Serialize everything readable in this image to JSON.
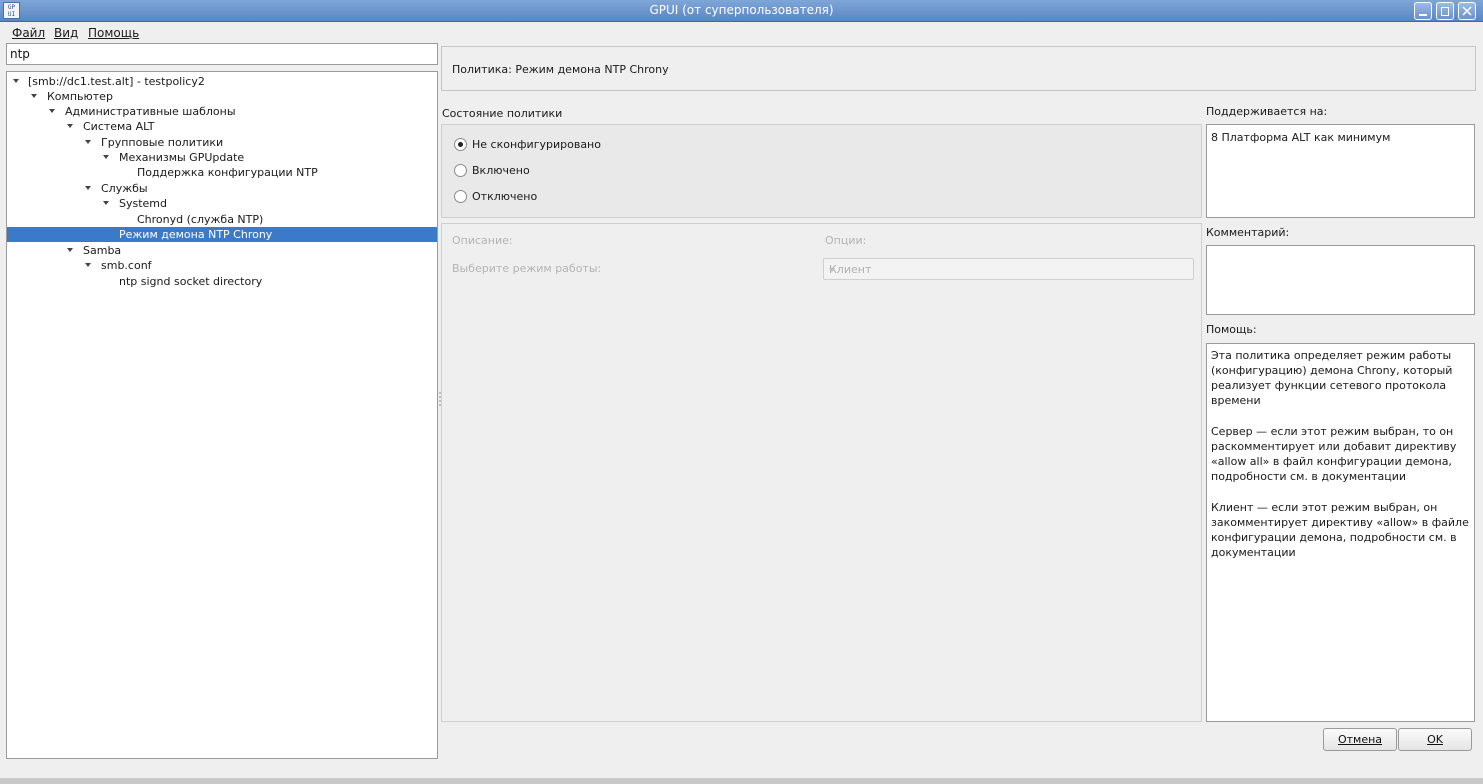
{
  "window": {
    "title": "GPUI (от суперпользователя)",
    "icon_text_top": "GP",
    "icon_text_bottom": "UI"
  },
  "menu": {
    "file": "Файл",
    "view": "Вид",
    "help": "Помощь"
  },
  "search": {
    "value": "ntp"
  },
  "tree": [
    {
      "label": "[smb://dc1.test.alt] - testpolicy2",
      "expanded": true
    },
    {
      "label": "Компьютер",
      "expanded": true
    },
    {
      "label": "Административные шаблоны",
      "expanded": true
    },
    {
      "label": "Система ALT",
      "expanded": true
    },
    {
      "label": "Групповые политики",
      "expanded": true
    },
    {
      "label": "Механизмы GPUpdate",
      "expanded": true
    },
    {
      "label": "Поддержка конфигурации NTP",
      "expanded": false
    },
    {
      "label": "Службы",
      "expanded": true
    },
    {
      "label": "Systemd",
      "expanded": true
    },
    {
      "label": "Chronyd (служба NTP)",
      "expanded": false
    },
    {
      "label": "Режим демона NTP Chrony",
      "expanded": false,
      "selected": true
    },
    {
      "label": "Samba",
      "expanded": true
    },
    {
      "label": "smb.conf",
      "expanded": true
    },
    {
      "label": "ntp signd socket directory",
      "expanded": false
    }
  ],
  "policy": {
    "header": "Политика: Режим демона NTP Chrony"
  },
  "state": {
    "label": "Состояние политики",
    "options": [
      "Не сконфигурировано",
      "Включено",
      "Отключено"
    ],
    "selected": "Не сконфигурировано"
  },
  "options_panel": {
    "description_label": "Описание:",
    "options_label": "Опции:",
    "mode_label": "Выберите режим работы:",
    "mode_value": "Клиент"
  },
  "supported": {
    "label": "Поддерживается на:",
    "value": "8 Платформа ALT как минимум"
  },
  "comment": {
    "label": "Комментарий:",
    "value": ""
  },
  "help": {
    "label": "Помощь:",
    "paragraphs": [
      "Эта политика определяет режим работы (конфигурацию) демона Chrony, который реализует функции сетевого протокола времени",
      "Сервер — если этот режим выбран, то он раскомментирует или добавит директиву «allow all» в файл конфигурации демона, подробности см. в документации",
      "Клиент — если этот режим выбран, он закомментирует директиву «allow» в файле конфигурации демона, подробности см. в документации"
    ]
  },
  "buttons": {
    "cancel": "Отмена",
    "ok": "OK"
  },
  "colors": {
    "selection": "#3b7ac8",
    "titlebar": "#6a92cc"
  }
}
